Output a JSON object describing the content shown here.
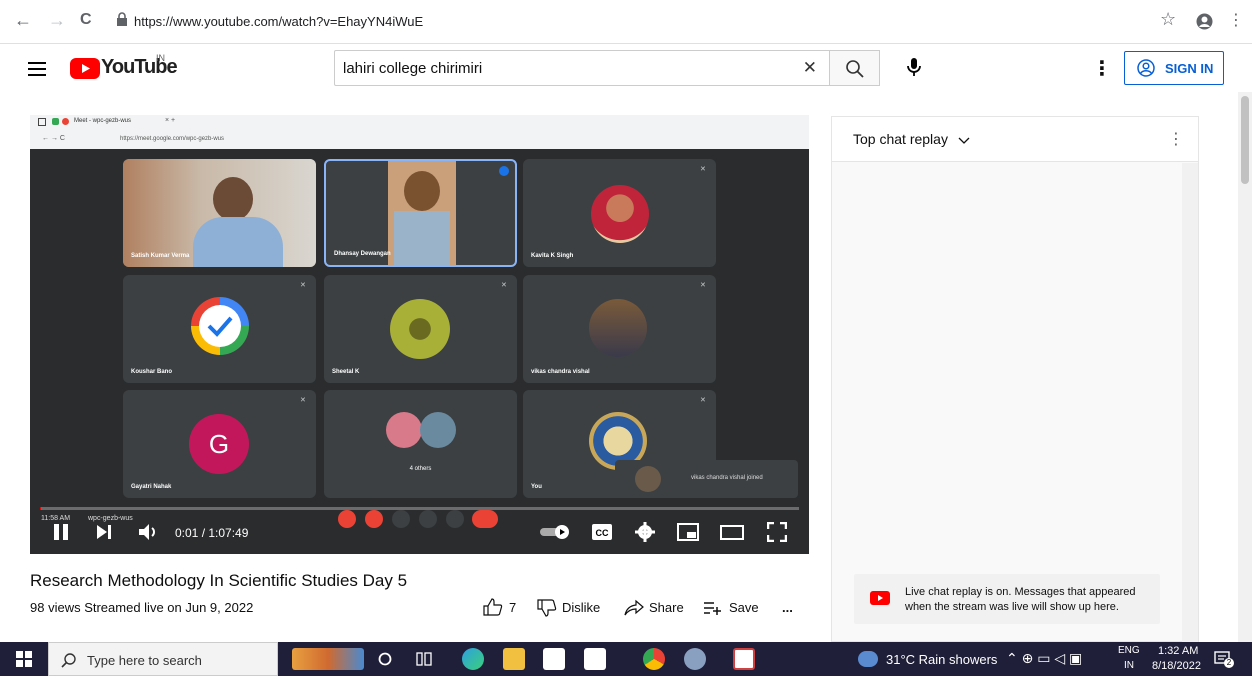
{
  "browser": {
    "url": "https://www.youtube.com/watch?v=EhayYN4iWuE",
    "back_icon": "←",
    "forward_icon": "→",
    "reload_icon": "C",
    "star_icon": "☆",
    "profile_icon": "●",
    "menu_icon": "⋮"
  },
  "youtube": {
    "logo_text": "YouTube",
    "logo_region": "IN",
    "search_value": "lahiri college chirimiri",
    "clear_icon": "✕",
    "signin_label": "SIGN IN",
    "more_icon": "⋮"
  },
  "meet_screen": {
    "tab_title": "Meet - wpc-gezb-wus",
    "inner_url": "https://meet.google.com/wpc-gezb-wus",
    "participants": [
      {
        "name": "Satish Kumar Verma"
      },
      {
        "name": "Dhansay Dewangan"
      },
      {
        "name": "Kavita K Singh"
      },
      {
        "name": "Koushar Bano"
      },
      {
        "name": "Sheetal K"
      },
      {
        "name": "vikas chandra vishal"
      },
      {
        "name": "Gayatri Nahak",
        "initial": "G"
      },
      {
        "name": "4 others"
      },
      {
        "name": "You"
      }
    ],
    "toast": "vikas chandra vishal joined",
    "meet_time": "11:58 AM",
    "meet_code": "wpc-gezb-wus"
  },
  "player": {
    "time_display": "0:01 / 1:07:49",
    "progress_fraction": 0.0
  },
  "video": {
    "title": "Research Methodology In Scientific Studies Day 5",
    "meta": "98 views  Streamed live on Jun 9, 2022",
    "likes": "7",
    "dislike_label": "Dislike",
    "share_label": "Share",
    "save_label": "Save",
    "more_label": "..."
  },
  "chat": {
    "header": "Top chat replay",
    "note_line1": "Live chat replay is on. Messages that appeared",
    "note_line2": "when the stream was live will show up here."
  },
  "taskbar": {
    "search_placeholder": "Type here to search",
    "weather": "31°C  Rain showers",
    "lang_top": "ENG",
    "lang_bottom": "IN",
    "time": "1:32 AM",
    "date": "8/18/2022",
    "notif_count": "2"
  }
}
